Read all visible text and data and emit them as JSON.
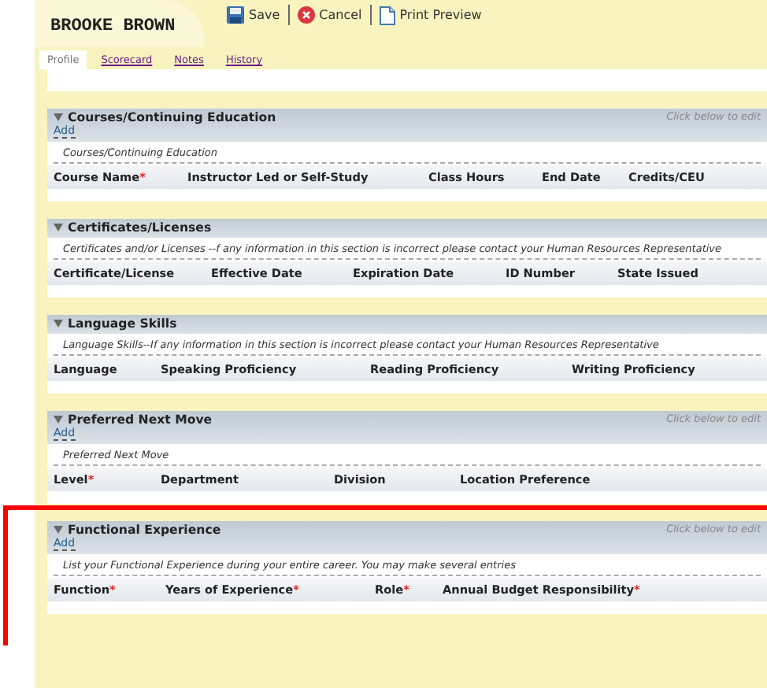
{
  "header": {
    "name": "BROOKE BROWN"
  },
  "toolbar": [
    {
      "kind": "save",
      "label": "Save"
    },
    {
      "kind": "cancel",
      "label": "Cancel"
    },
    {
      "kind": "print",
      "label": "Print Preview"
    }
  ],
  "tabs": [
    {
      "label": "Profile",
      "selected": true
    },
    {
      "label": "Scorecard",
      "selected": false
    },
    {
      "label": "Notes",
      "selected": false
    },
    {
      "label": "History",
      "selected": false
    }
  ],
  "sections": [
    {
      "title": "Courses/Continuing Education",
      "add": "Add",
      "edit_hint": "Click below to edit",
      "description": "Courses/Continuing Education",
      "highlighted": false,
      "columns": [
        {
          "label": "Course Name",
          "mark": "*"
        },
        {
          "label": "Instructor Led or Self-Study"
        },
        {
          "label": "Class Hours"
        },
        {
          "label": "End Date"
        },
        {
          "label": "Credits/CEU"
        }
      ]
    },
    {
      "title": "Certificates/Licenses",
      "description": "Certificates and/or Licenses --f any information in this section is incorrect please contact your Human Resources Representative",
      "highlighted": false,
      "columns": [
        {
          "label": "Certificate/License"
        },
        {
          "label": "Effective Date"
        },
        {
          "label": "Expiration Date"
        },
        {
          "label": "ID Number"
        },
        {
          "label": "State Issued"
        }
      ]
    },
    {
      "title": "Language Skills",
      "description": "Language Skills--If any information in this section is incorrect please contact your Human Resources Representative",
      "highlighted": false,
      "columns": [
        {
          "label": "Language"
        },
        {
          "label": "Speaking Proficiency"
        },
        {
          "label": "Reading Proficiency"
        },
        {
          "label": "Writing Proficiency"
        }
      ]
    },
    {
      "title": "Preferred Next Move",
      "add": "Add",
      "edit_hint": "Click below to edit",
      "description": "Preferred Next Move",
      "highlighted": false,
      "columns": [
        {
          "label": "Level",
          "mark": "*"
        },
        {
          "label": "Department"
        },
        {
          "label": "Division"
        },
        {
          "label": "Location Preference"
        }
      ]
    },
    {
      "title": "Functional Experience",
      "add": "Add",
      "edit_hint": "Click below to edit",
      "description": "List your Functional Experience during your entire career. You may make several entries",
      "highlighted": true,
      "columns": [
        {
          "label": "Function",
          "mark": "*"
        },
        {
          "label": "Years of Experience",
          "mark": "*"
        },
        {
          "label": "Role",
          "mark": "*"
        },
        {
          "label": "Annual Budget Responsibility",
          "mark": "*"
        }
      ]
    }
  ]
}
